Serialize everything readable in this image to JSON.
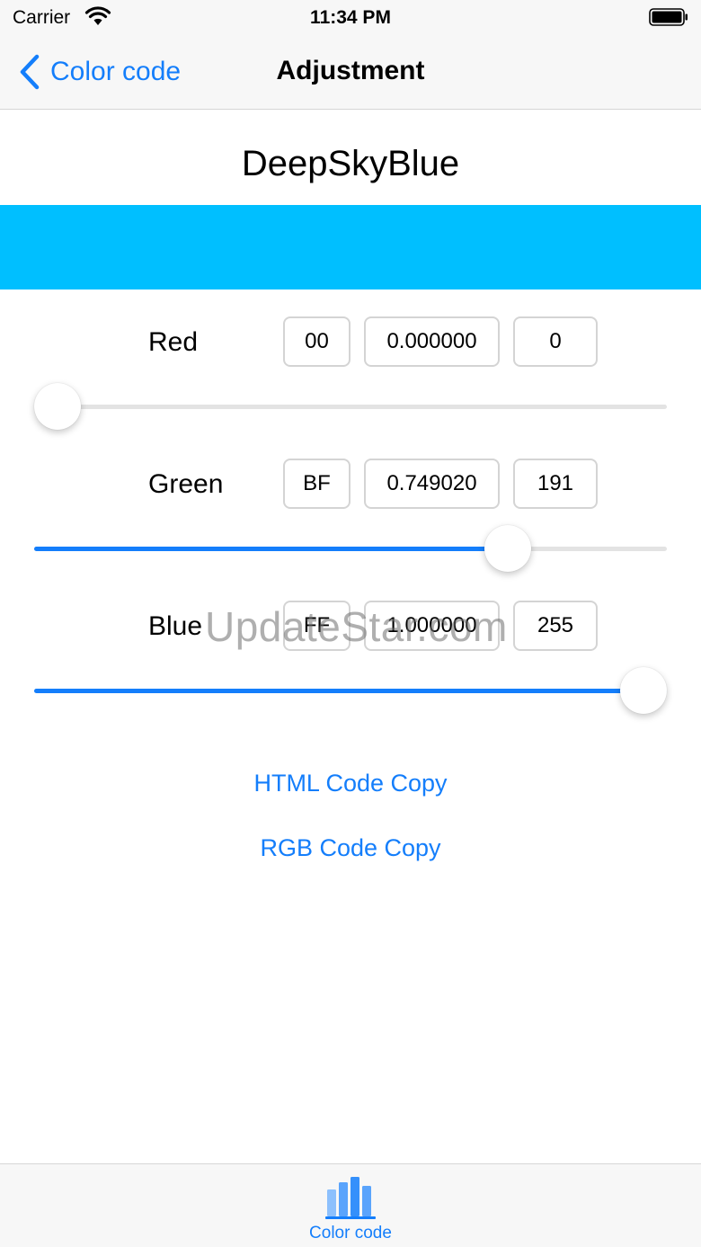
{
  "status_bar": {
    "carrier": "Carrier",
    "time": "11:34 PM"
  },
  "nav": {
    "back_label": "Color code",
    "title": "Adjustment"
  },
  "color": {
    "name": "DeepSkyBlue",
    "hex_color": "#00BFFF"
  },
  "channels": [
    {
      "label": "Red",
      "hex": "00",
      "fraction": "0.000000",
      "value": "0",
      "level": 0.0
    },
    {
      "label": "Green",
      "hex": "BF",
      "fraction": "0.749020",
      "value": "191",
      "level": 0.74902
    },
    {
      "label": "Blue",
      "hex": "FF",
      "fraction": "1.000000",
      "value": "255",
      "level": 1.0
    }
  ],
  "actions": {
    "html_copy": "HTML Code Copy",
    "rgb_copy": "RGB Code Copy"
  },
  "watermark": "UpdateStar.com",
  "tab_bar": {
    "items": [
      {
        "label": "Color code",
        "icon": "bar-chart-icon",
        "selected": true
      }
    ]
  },
  "colors": {
    "accent": "#147efb",
    "track": "#e3e3e3",
    "bar_background": "#f7f7f7"
  }
}
